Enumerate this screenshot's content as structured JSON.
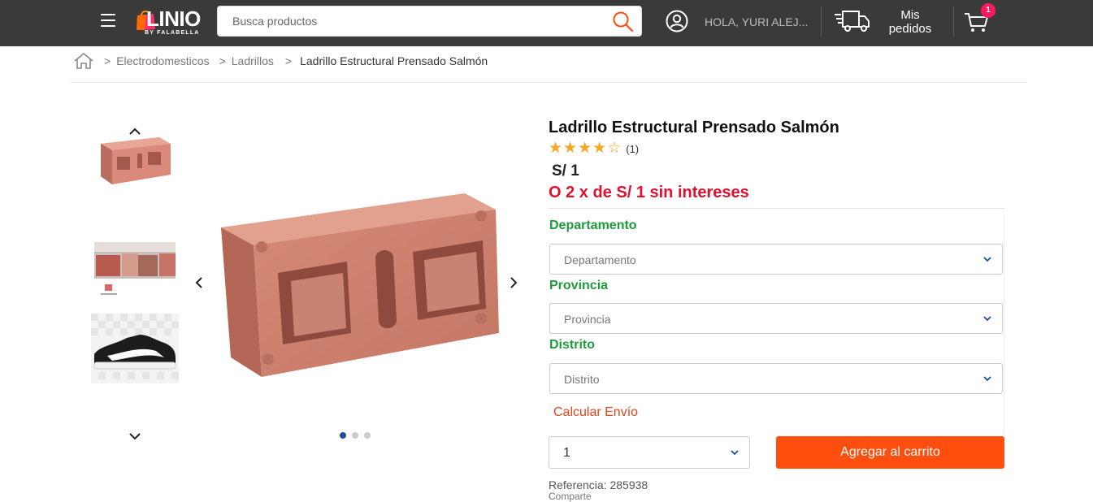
{
  "header": {
    "logo_text": "LINIO",
    "logo_sub": "BY FALABELLA",
    "search_placeholder": "Busca productos",
    "greeting": "HOLA, YURI ALEJ...",
    "orders_line1": "Mis",
    "orders_line2": "pedidos",
    "cart_count": "1",
    "accent_color": "#ff1a5e"
  },
  "breadcrumb": {
    "items": [
      "Electrodomesticos",
      "Ladrillos"
    ],
    "current": "Ladrillo Estructural Prensado Salmón",
    "separator": ">"
  },
  "gallery": {
    "active_dot": 0,
    "dot_count": 3
  },
  "product": {
    "title": "Ladrillo Estructural Prensado Salmón",
    "rating": 4,
    "rating_max": 5,
    "reviews": "(1)",
    "price": "S/ 1",
    "installment": "O 2 x de S/ 1 sin intereses",
    "reference": "Referencia: 285938",
    "share": "Comparte"
  },
  "shipping": {
    "department_label": "Departamento",
    "department_placeholder": "Departamento",
    "province_label": "Provincia",
    "province_placeholder": "Provincia",
    "district_label": "Distrito",
    "district_placeholder": "Distrito",
    "calculate": "Calcular Envío"
  },
  "purchase": {
    "quantity": "1",
    "add_to_cart": "Agregar al carrito"
  }
}
